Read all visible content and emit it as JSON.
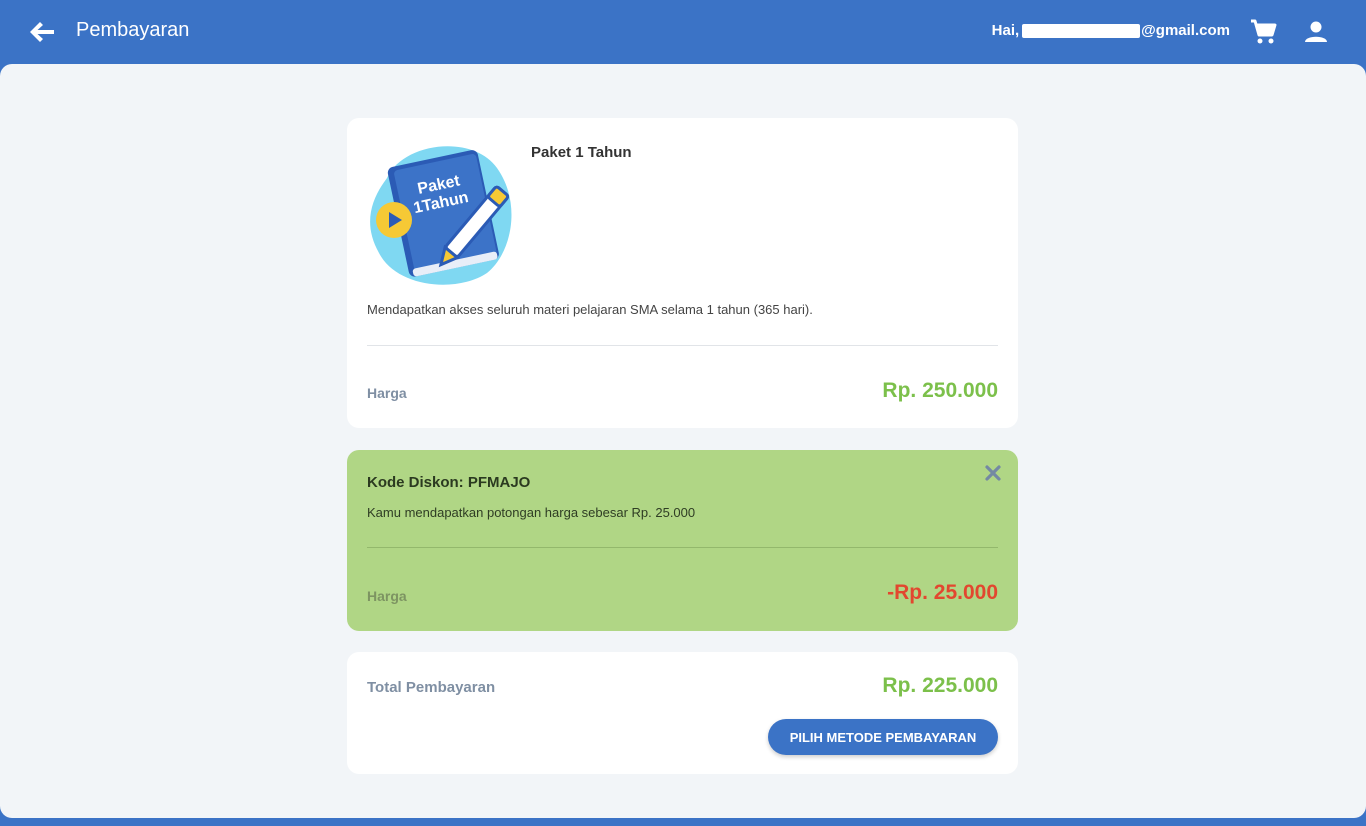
{
  "header": {
    "title": "Pembayaran",
    "greeting_prefix": "Hai,",
    "email_suffix": "@gmail.com",
    "icons": {
      "back": "arrow-left-icon",
      "cart": "cart-icon",
      "user": "user-icon"
    }
  },
  "product": {
    "image_text_line1": "Paket",
    "image_text_line2": "1Tahun",
    "name": "Paket 1 Tahun",
    "description": "Mendapatkan akses seluruh materi pelajaran SMA selama 1 tahun (365 hari).",
    "price_label": "Harga",
    "price": "Rp. 250.000"
  },
  "discount": {
    "title": "Kode Diskon: PFMAJO",
    "description": "Kamu mendapatkan potongan harga sebesar Rp. 25.000",
    "price_label": "Harga",
    "amount": "-Rp. 25.000",
    "close_icon": "close-icon"
  },
  "total": {
    "label": "Total Pembayaran",
    "amount": "Rp. 225.000",
    "button_label": "PILIH METODE PEMBAYARAN"
  },
  "colors": {
    "primary": "#3b73c6",
    "price_green": "#7cc04b",
    "discount_bg": "#b0d685",
    "discount_red": "#e2472f",
    "background": "#f2f5f8"
  }
}
